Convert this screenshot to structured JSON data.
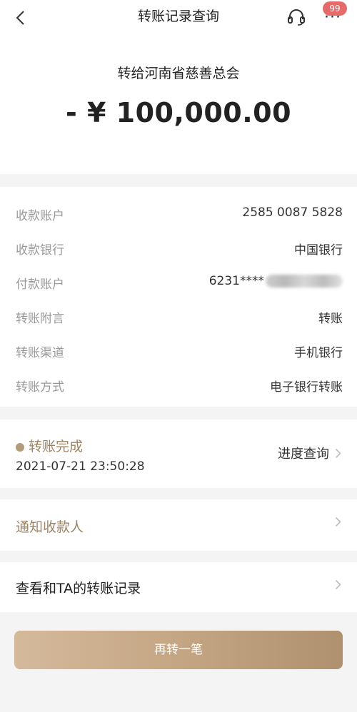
{
  "nav": {
    "title": "转账记录查询",
    "more_glyph": "···",
    "badge_count": "99",
    "icons": [
      "back-chevron-icon",
      "headset-icon",
      "more-icon"
    ]
  },
  "summary": {
    "payee": "转给河南省慈善总会",
    "amount": "- ¥ 100,000.00"
  },
  "details": {
    "rows": [
      {
        "label": "收款账户",
        "value": "2585 0087 5828"
      },
      {
        "label": "收款银行",
        "value": "中国银行"
      },
      {
        "label": "付款账户",
        "value": "6231****"
      },
      {
        "label": "转账附言",
        "value": "转账"
      },
      {
        "label": "转账渠道",
        "value": "手机银行"
      },
      {
        "label": "转账方式",
        "value": "电子银行转账"
      }
    ]
  },
  "status": {
    "text": "转账完成",
    "time": "2021-07-21 23:50:28",
    "progress_link": "进度查询",
    "dot_color": "#b39b7c"
  },
  "notify": {
    "label": "通知收款人"
  },
  "history": {
    "label": "查看和TA的转账记录"
  },
  "action": {
    "again_label": "再转一笔"
  },
  "colors": {
    "accent_gold": "#9c8466",
    "button_gradient_start": "#d4b99b",
    "button_gradient_end": "#b0916f",
    "badge_red": "#e56b6b"
  }
}
